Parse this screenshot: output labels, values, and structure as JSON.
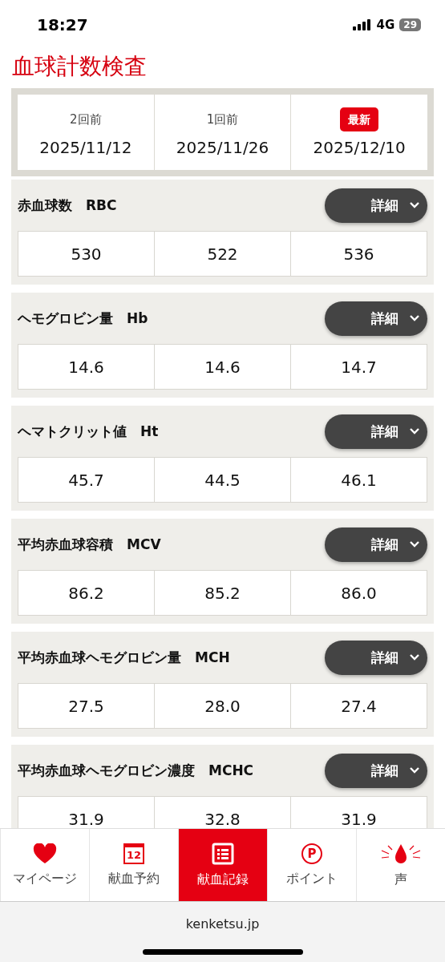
{
  "status_bar": {
    "time": "18:27",
    "network": "4G",
    "battery": "29"
  },
  "title": "血球計数検査",
  "columns": [
    {
      "label": "2回前",
      "date": "2025/11/12"
    },
    {
      "label": "1回前",
      "date": "2025/11/26"
    },
    {
      "badge": "最新",
      "date": "2025/12/10"
    }
  ],
  "sections": [
    {
      "name": "赤血球数　RBC",
      "button": "詳細",
      "expanded": false,
      "values": [
        "530",
        "522",
        "536"
      ]
    },
    {
      "name": "ヘモグロビン量　Hb",
      "button": "詳細",
      "expanded": false,
      "values": [
        "14.6",
        "14.6",
        "14.7"
      ]
    },
    {
      "name": "ヘマトクリット値　Ht",
      "button": "詳細",
      "expanded": false,
      "values": [
        "45.7",
        "44.5",
        "46.1"
      ]
    },
    {
      "name": "平均赤血球容積　MCV",
      "button": "詳細",
      "expanded": false,
      "values": [
        "86.2",
        "85.2",
        "86.0"
      ]
    },
    {
      "name": "平均赤血球ヘモグロビン量　MCH",
      "button": "詳細",
      "expanded": false,
      "values": [
        "27.5",
        "28.0",
        "27.4"
      ]
    },
    {
      "name": "平均赤血球ヘモグロビン濃度　MCHC",
      "button": "詳細",
      "expanded": false,
      "values": [
        "31.9",
        "32.8",
        "31.9"
      ]
    }
  ],
  "nav": [
    {
      "kind": "heart",
      "label": "マイページ",
      "selected": false
    },
    {
      "kind": "calendar",
      "label": "献血予約",
      "icon_text": "12",
      "selected": false
    },
    {
      "kind": "list",
      "label": "献血記録",
      "selected": true
    },
    {
      "kind": "point",
      "label": "ポイント",
      "icon_text": "P",
      "selected": false
    },
    {
      "kind": "drop",
      "label": "声",
      "selected": false
    }
  ],
  "browser": {
    "url": "kenketsu.jp"
  }
}
